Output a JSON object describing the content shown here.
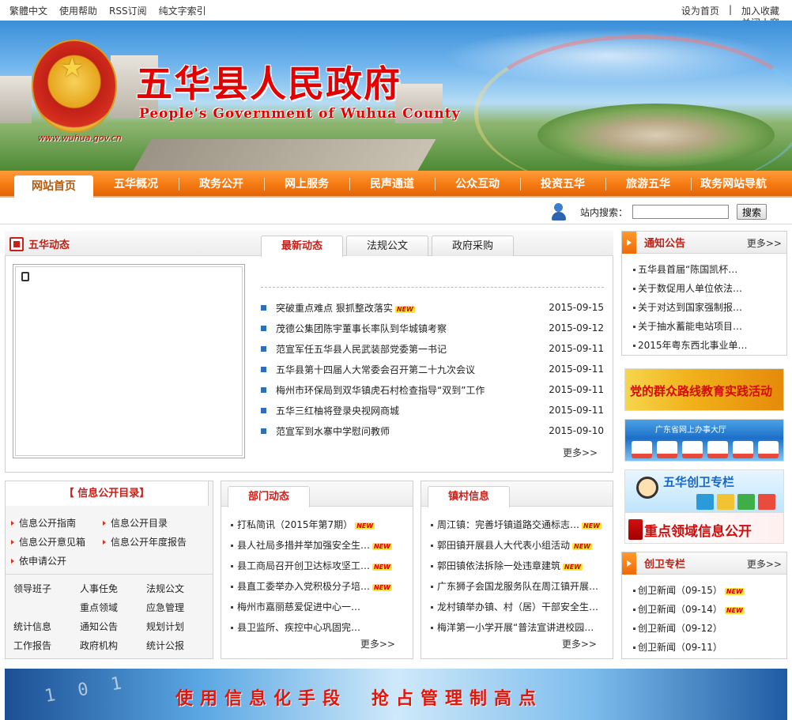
{
  "topbar": {
    "left_links": [
      "繁體中文",
      "使用帮助",
      "RSS订阅",
      "纯文字索引"
    ],
    "set_home": "设为首页",
    "separator": "|",
    "add_fav": "加入收藏",
    "close_ad": "关闭小窗"
  },
  "banner": {
    "title_cn": "五华县人民政府",
    "title_en": "People's Government of Wuhua County",
    "url": "www.wuhua.gov.cn"
  },
  "nav": {
    "items": [
      "网站首页",
      "五华概况",
      "政务公开",
      "网上服务",
      "民声通道",
      "公众互动",
      "投资五华",
      "旅游五华",
      "政务网站导航"
    ]
  },
  "search": {
    "label": "站内搜索：",
    "value": "",
    "button": "搜索"
  },
  "news": {
    "section_title": "五华动态",
    "tabs": [
      "最新动态",
      "法规公文",
      "政府采购"
    ],
    "items": [
      {
        "title": "突破重点难点 狠抓整改落实",
        "date": "2015-09-15",
        "new": "NEW"
      },
      {
        "title": "茂德公集团陈宇董事长率队到华城镇考察",
        "date": "2015-09-12"
      },
      {
        "title": "范宣军任五华县人民武装部党委第一书记",
        "date": "2015-09-11"
      },
      {
        "title": "五华县第十四届人大常委会召开第二十九次会议",
        "date": "2015-09-11"
      },
      {
        "title": "梅州市环保局到双华镇虎石村检查指导“双到”工作",
        "date": "2015-09-11"
      },
      {
        "title": "五华三红柚将登录央视网商城",
        "date": "2015-09-11"
      },
      {
        "title": "范宣军到水寨中学慰问教师",
        "date": "2015-09-10"
      }
    ],
    "more": "更多>>"
  },
  "notice": {
    "title": "通知公告",
    "more": "更多>>",
    "items": [
      "五华县首届“陈国凯杯…",
      "关于数促用人单位依法…",
      "关于对达到国家强制报…",
      "关于抽水蓄能电站项目…",
      "2015年粤东西北事业单…"
    ]
  },
  "ads": {
    "ad1": "党的群众路线教育实践活动",
    "ad2": "广东省网上办事大厅",
    "ad3": "五华创卫专栏",
    "ad4": "重点领域信息公开"
  },
  "chuangwei": {
    "title": "创卫专栏",
    "more": "更多>>",
    "items": [
      {
        "title": "创卫新闻（09-15）",
        "new": "NEW"
      },
      {
        "title": "创卫新闻（09-14）",
        "new": "NEW"
      },
      {
        "title": "创卫新闻（09-12）"
      },
      {
        "title": "创卫新闻（09-11）"
      }
    ]
  },
  "info": {
    "title": "【 信息公开目录】",
    "links": [
      "信息公开指南",
      "信息公开目录",
      "信息公开意见箱",
      "信息公开年度报告",
      "依申请公开"
    ],
    "grid": [
      "领导班子",
      "人事任免",
      "法规公文",
      "",
      "重点领域",
      "应急管理",
      "统计信息",
      "通知公告",
      "规划计划",
      "工作报告",
      "政府机构",
      "统计公报"
    ]
  },
  "dept": {
    "title": "部门动态",
    "items": [
      {
        "title": "打私简讯（2015年第7期）",
        "new": "NEW"
      },
      {
        "title": "县人社局多措并举加强安全生…",
        "new": "NEW"
      },
      {
        "title": "县工商局召开创卫达标攻坚工…",
        "new": "NEW"
      },
      {
        "title": "县直工委举办入党积极分子培…",
        "new": "NEW"
      },
      {
        "title": "梅州市嘉丽慈爱促进中心一…"
      },
      {
        "title": "县卫监所、疾控中心巩固完…"
      }
    ],
    "more": "更多>>"
  },
  "town": {
    "title": "镇村信息",
    "items": [
      {
        "title": "周江镇：完善圩镇道路交通标志…",
        "new": "NEW"
      },
      {
        "title": "郭田镇开展县人大代表小组活动",
        "new": "NEW"
      },
      {
        "title": "郭田镇依法拆除一处违章建筑",
        "new": "NEW"
      },
      {
        "title": "广东狮子会国龙服务队在周江镇开展…"
      },
      {
        "title": "龙村镇举办镇、村（居）干部安全生…"
      },
      {
        "title": "梅洋第一小学开展“普法宣讲进校园…"
      }
    ],
    "more": "更多>>"
  },
  "bottom_banner": {
    "digits": "1 0 1",
    "slogan": "使用信息化手段　抢占管理制高点"
  }
}
